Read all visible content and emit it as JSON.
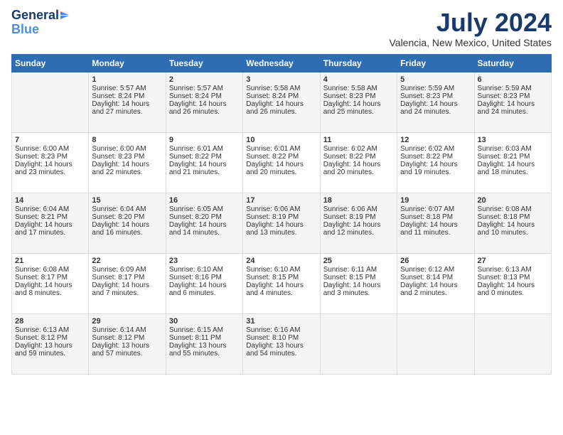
{
  "logo": {
    "line1": "General",
    "line2": "Blue"
  },
  "title": "July 2024",
  "subtitle": "Valencia, New Mexico, United States",
  "days_of_week": [
    "Sunday",
    "Monday",
    "Tuesday",
    "Wednesday",
    "Thursday",
    "Friday",
    "Saturday"
  ],
  "weeks": [
    [
      {
        "day": "",
        "content": ""
      },
      {
        "day": "1",
        "content": "Sunrise: 5:57 AM\nSunset: 8:24 PM\nDaylight: 14 hours\nand 27 minutes."
      },
      {
        "day": "2",
        "content": "Sunrise: 5:57 AM\nSunset: 8:24 PM\nDaylight: 14 hours\nand 26 minutes."
      },
      {
        "day": "3",
        "content": "Sunrise: 5:58 AM\nSunset: 8:24 PM\nDaylight: 14 hours\nand 26 minutes."
      },
      {
        "day": "4",
        "content": "Sunrise: 5:58 AM\nSunset: 8:23 PM\nDaylight: 14 hours\nand 25 minutes."
      },
      {
        "day": "5",
        "content": "Sunrise: 5:59 AM\nSunset: 8:23 PM\nDaylight: 14 hours\nand 24 minutes."
      },
      {
        "day": "6",
        "content": "Sunrise: 5:59 AM\nSunset: 8:23 PM\nDaylight: 14 hours\nand 24 minutes."
      }
    ],
    [
      {
        "day": "7",
        "content": "Sunrise: 6:00 AM\nSunset: 8:23 PM\nDaylight: 14 hours\nand 23 minutes."
      },
      {
        "day": "8",
        "content": "Sunrise: 6:00 AM\nSunset: 8:23 PM\nDaylight: 14 hours\nand 22 minutes."
      },
      {
        "day": "9",
        "content": "Sunrise: 6:01 AM\nSunset: 8:22 PM\nDaylight: 14 hours\nand 21 minutes."
      },
      {
        "day": "10",
        "content": "Sunrise: 6:01 AM\nSunset: 8:22 PM\nDaylight: 14 hours\nand 20 minutes."
      },
      {
        "day": "11",
        "content": "Sunrise: 6:02 AM\nSunset: 8:22 PM\nDaylight: 14 hours\nand 20 minutes."
      },
      {
        "day": "12",
        "content": "Sunrise: 6:02 AM\nSunset: 8:22 PM\nDaylight: 14 hours\nand 19 minutes."
      },
      {
        "day": "13",
        "content": "Sunrise: 6:03 AM\nSunset: 8:21 PM\nDaylight: 14 hours\nand 18 minutes."
      }
    ],
    [
      {
        "day": "14",
        "content": "Sunrise: 6:04 AM\nSunset: 8:21 PM\nDaylight: 14 hours\nand 17 minutes."
      },
      {
        "day": "15",
        "content": "Sunrise: 6:04 AM\nSunset: 8:20 PM\nDaylight: 14 hours\nand 16 minutes."
      },
      {
        "day": "16",
        "content": "Sunrise: 6:05 AM\nSunset: 8:20 PM\nDaylight: 14 hours\nand 14 minutes."
      },
      {
        "day": "17",
        "content": "Sunrise: 6:06 AM\nSunset: 8:19 PM\nDaylight: 14 hours\nand 13 minutes."
      },
      {
        "day": "18",
        "content": "Sunrise: 6:06 AM\nSunset: 8:19 PM\nDaylight: 14 hours\nand 12 minutes."
      },
      {
        "day": "19",
        "content": "Sunrise: 6:07 AM\nSunset: 8:18 PM\nDaylight: 14 hours\nand 11 minutes."
      },
      {
        "day": "20",
        "content": "Sunrise: 6:08 AM\nSunset: 8:18 PM\nDaylight: 14 hours\nand 10 minutes."
      }
    ],
    [
      {
        "day": "21",
        "content": "Sunrise: 6:08 AM\nSunset: 8:17 PM\nDaylight: 14 hours\nand 8 minutes."
      },
      {
        "day": "22",
        "content": "Sunrise: 6:09 AM\nSunset: 8:17 PM\nDaylight: 14 hours\nand 7 minutes."
      },
      {
        "day": "23",
        "content": "Sunrise: 6:10 AM\nSunset: 8:16 PM\nDaylight: 14 hours\nand 6 minutes."
      },
      {
        "day": "24",
        "content": "Sunrise: 6:10 AM\nSunset: 8:15 PM\nDaylight: 14 hours\nand 4 minutes."
      },
      {
        "day": "25",
        "content": "Sunrise: 6:11 AM\nSunset: 8:15 PM\nDaylight: 14 hours\nand 3 minutes."
      },
      {
        "day": "26",
        "content": "Sunrise: 6:12 AM\nSunset: 8:14 PM\nDaylight: 14 hours\nand 2 minutes."
      },
      {
        "day": "27",
        "content": "Sunrise: 6:13 AM\nSunset: 8:13 PM\nDaylight: 14 hours\nand 0 minutes."
      }
    ],
    [
      {
        "day": "28",
        "content": "Sunrise: 6:13 AM\nSunset: 8:12 PM\nDaylight: 13 hours\nand 59 minutes."
      },
      {
        "day": "29",
        "content": "Sunrise: 6:14 AM\nSunset: 8:12 PM\nDaylight: 13 hours\nand 57 minutes."
      },
      {
        "day": "30",
        "content": "Sunrise: 6:15 AM\nSunset: 8:11 PM\nDaylight: 13 hours\nand 55 minutes."
      },
      {
        "day": "31",
        "content": "Sunrise: 6:16 AM\nSunset: 8:10 PM\nDaylight: 13 hours\nand 54 minutes."
      },
      {
        "day": "",
        "content": ""
      },
      {
        "day": "",
        "content": ""
      },
      {
        "day": "",
        "content": ""
      }
    ]
  ]
}
